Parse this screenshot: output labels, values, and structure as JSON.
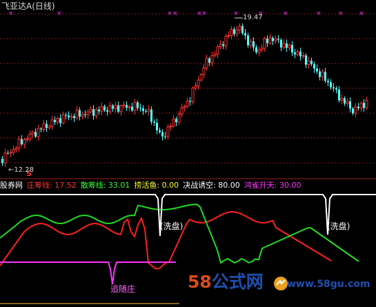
{
  "title": {
    "name": "飞亚达A",
    "period": "(日线)"
  },
  "price": {
    "high_label": "19.47",
    "low_label": "←12.28",
    "signal_mark": "S"
  },
  "indicator": {
    "name": "股券网",
    "values": [
      {
        "label": "庄筹线:",
        "value": "17.52",
        "color": "#ff3333"
      },
      {
        "label": "散筹线:",
        "value": "33.01",
        "color": "#33ff33"
      },
      {
        "label": "捞活鱼:",
        "value": "0.00",
        "color": "#ffff33"
      },
      {
        "label": "决战诱空:",
        "value": "80.00",
        "color": "#ffffff"
      },
      {
        "label": "鸿雀升天:",
        "value": "30.00",
        "color": "#ff33ff"
      }
    ]
  },
  "annotations": {
    "wash_1": "(洗盘)",
    "wash_2": "(洗盘)",
    "chase": "追随庄"
  },
  "watermark": {
    "main_num": "58",
    "main_text": "公式网",
    "url": "www.58gu.com"
  },
  "colors": {
    "background": "#000000",
    "up_candle": "#ff3232",
    "down_candle": "#54ffff",
    "grid": "#8b1a1a",
    "marker": "#ff33ff",
    "zhuang_line": "#ff2020",
    "san_line": "#22dd22",
    "white_line": "#ffffff",
    "magenta_line": "#ff33ff",
    "yellow_line": "#ffcc33"
  }
}
